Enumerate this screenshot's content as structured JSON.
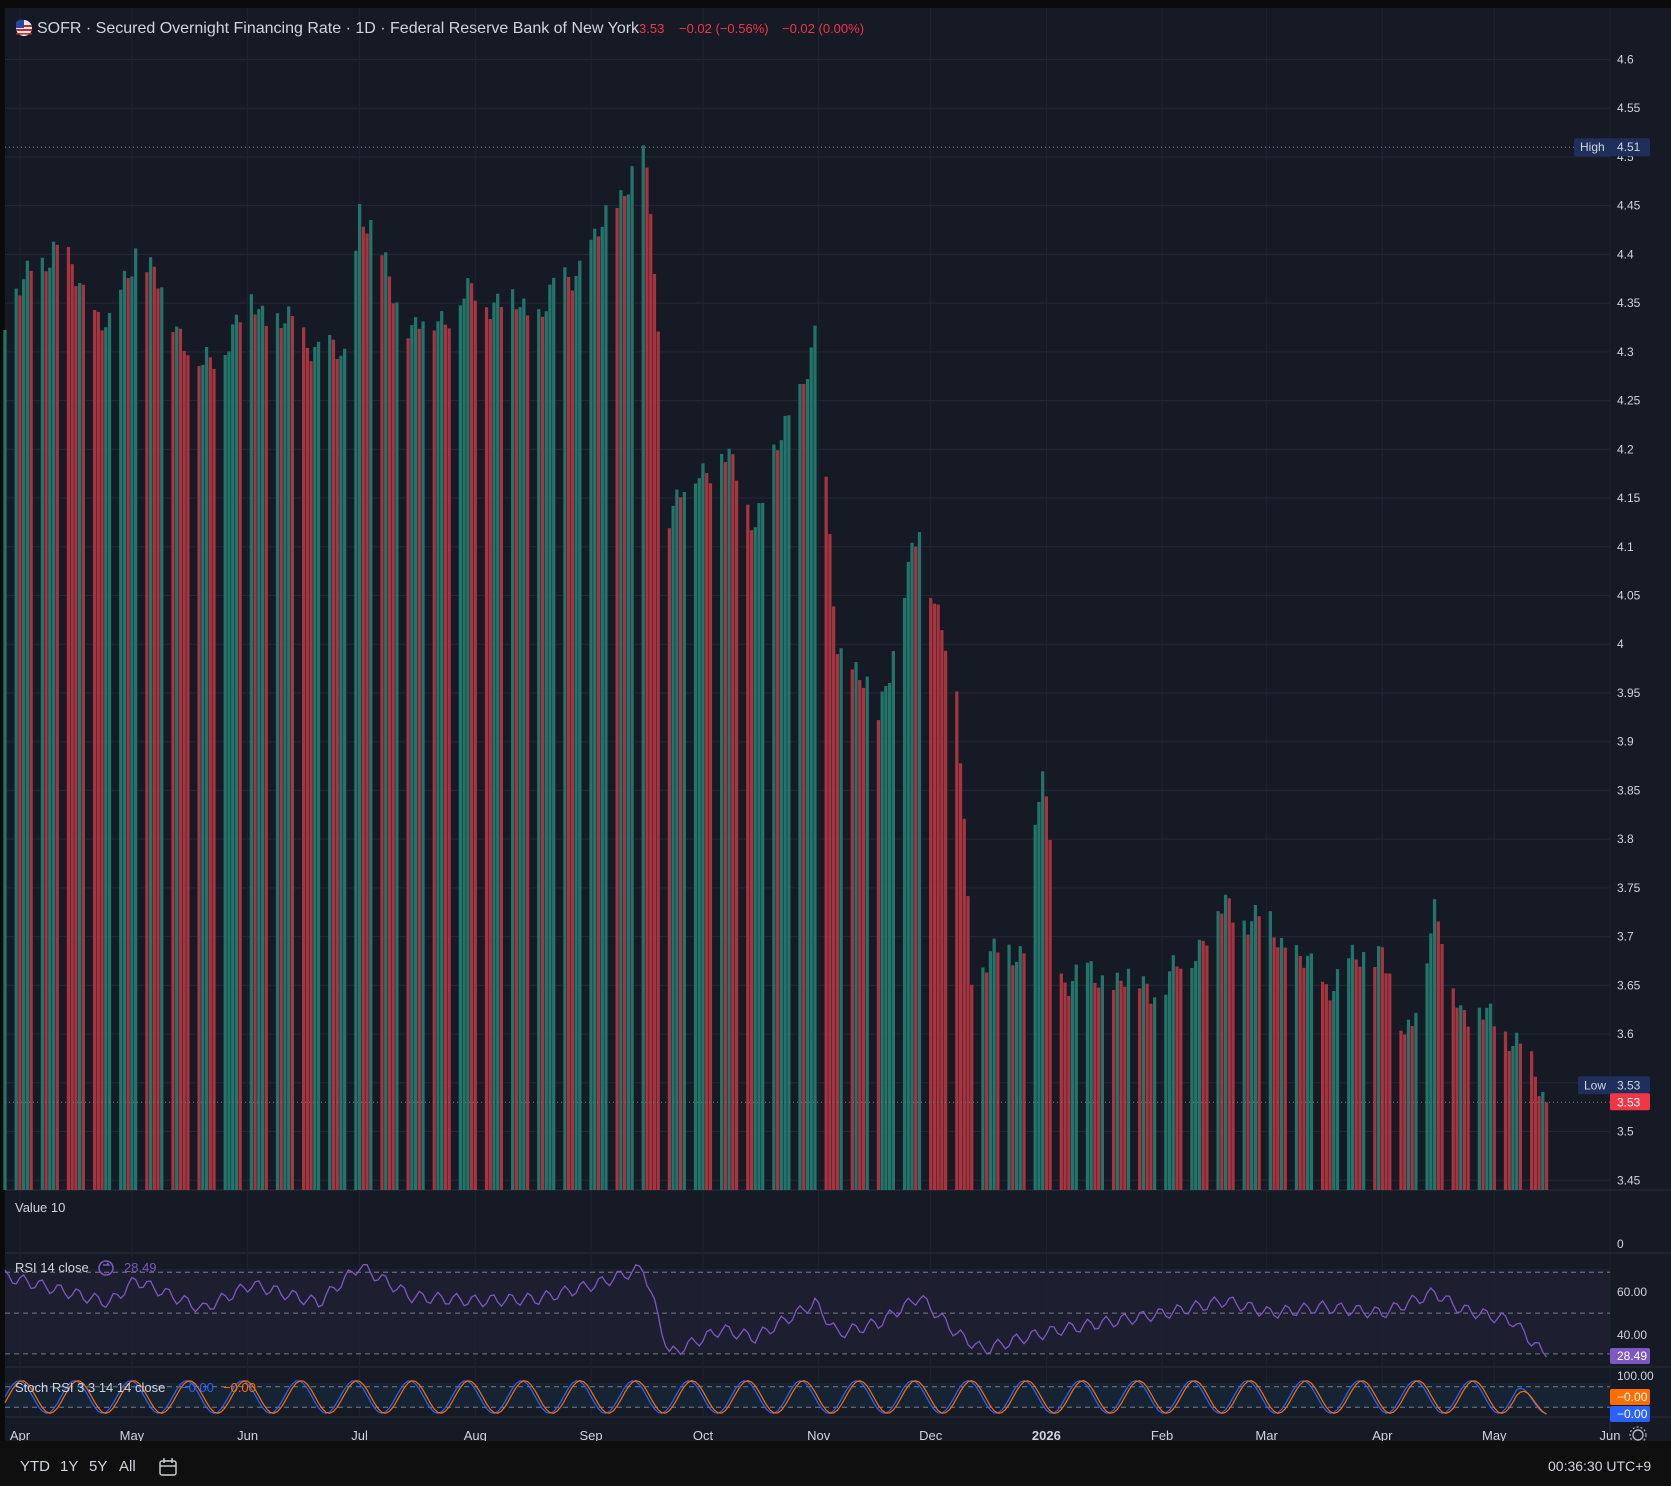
{
  "header": {
    "flag_icon": "us-flag-icon",
    "symbol": "SOFR",
    "title": "SOFR · Secured Overnight Financing Rate · 1D · Federal Reserve Bank of New York",
    "last": "3.53",
    "change": "−0.02 (−0.56%)",
    "change2": "−0.02 (0.00%)"
  },
  "price_axis": {
    "labels": [
      "4.6",
      "4.55",
      "4.5",
      "4.45",
      "4.4",
      "4.35",
      "4.3",
      "4.25",
      "4.2",
      "4.15",
      "4.1",
      "4.05",
      "4",
      "3.95",
      "3.9",
      "3.85",
      "3.8",
      "3.75",
      "3.7",
      "3.65",
      "3.6",
      "3.55",
      "3.5",
      "3.45"
    ],
    "high_label": "High",
    "high_value": "4.51",
    "low_label": "Low",
    "low_value": "3.53",
    "last_value": "3.53"
  },
  "volume_pane": {
    "label": "Value 10",
    "axis_zero": "0"
  },
  "rsi_pane": {
    "label": "RSI 14 close",
    "value": "28.49",
    "axis": [
      "60.00",
      "40.00"
    ],
    "last": "28.49"
  },
  "stoch_pane": {
    "label": "Stoch RSI 3 3 14 14 close",
    "k_value": "−0.00",
    "d_value": "−0.00",
    "axis_top": "100.00",
    "k_last": "−0.00",
    "d_last": "−0.00"
  },
  "time_axis": {
    "labels": [
      "Apr",
      "May",
      "Jun",
      "Jul",
      "Aug",
      "Sep",
      "Oct",
      "Nov",
      "Dec",
      "2026",
      "Feb",
      "Mar",
      "Apr",
      "May",
      "Jun"
    ]
  },
  "toolbar": {
    "ranges": [
      "YTD",
      "1Y",
      "5Y",
      "All"
    ],
    "calendar_icon": "calendar-goto-icon",
    "clock": "00:36:30 UTC+9",
    "settings_icon": "gear-icon"
  },
  "colors": {
    "up": "#22756a",
    "down": "#a83440",
    "rsi": "#7e57c2",
    "stoch_k": "#2962ff",
    "stoch_d": "#ff6d00",
    "background": "#161a25",
    "high_badge": "#1e2f5c",
    "last_badge": "#f23645"
  },
  "chart_data": [
    {
      "type": "bar",
      "title": "SOFR · Secured Overnight Financing Rate · 1D · Federal Reserve Bank of New York",
      "ylim": [
        3.44,
        4.62
      ],
      "x_range": [
        "2025-03-28",
        "2026-06-01"
      ],
      "series": [
        {
          "name": "SOFR",
          "segments": [
            {
              "x": [
                "2025-03-28",
                "2025-04-10"
              ],
              "values": [
                4.34,
                4.41
              ]
            },
            {
              "x": [
                "2025-04-10",
                "2025-04-25"
              ],
              "values": [
                4.41,
                4.32
              ]
            },
            {
              "x": [
                "2025-04-25",
                "2025-05-02"
              ],
              "values": [
                4.32,
                4.41
              ]
            },
            {
              "x": [
                "2025-05-02",
                "2025-05-20"
              ],
              "values": [
                4.41,
                4.28
              ]
            },
            {
              "x": [
                "2025-05-20",
                "2025-06-02"
              ],
              "values": [
                4.28,
                4.35
              ]
            },
            {
              "x": [
                "2025-06-02",
                "2025-06-27"
              ],
              "values": [
                4.35,
                4.29
              ]
            },
            {
              "x": [
                "2025-06-27",
                "2025-07-01"
              ],
              "values": [
                4.29,
                4.45
              ]
            },
            {
              "x": [
                "2025-07-01",
                "2025-07-15"
              ],
              "values": [
                4.45,
                4.32
              ]
            },
            {
              "x": [
                "2025-07-15",
                "2025-08-01"
              ],
              "values": [
                4.32,
                4.36
              ]
            },
            {
              "x": [
                "2025-08-01",
                "2025-08-18"
              ],
              "values": [
                4.36,
                4.34
              ]
            },
            {
              "x": [
                "2025-08-18",
                "2025-09-02"
              ],
              "values": [
                4.34,
                4.41
              ]
            },
            {
              "x": [
                "2025-09-02",
                "2025-09-15"
              ],
              "values": [
                4.41,
                4.51
              ]
            },
            {
              "x": [
                "2025-09-15",
                "2025-09-18"
              ],
              "values": [
                4.51,
                4.39
              ]
            },
            {
              "x": [
                "2025-09-18",
                "2025-09-22"
              ],
              "values": [
                4.39,
                4.14
              ]
            },
            {
              "x": [
                "2025-09-22",
                "2025-10-06"
              ],
              "values": [
                4.14,
                4.2
              ]
            },
            {
              "x": [
                "2025-10-06",
                "2025-10-15"
              ],
              "values": [
                4.2,
                4.13
              ]
            },
            {
              "x": [
                "2025-10-15",
                "2025-10-31"
              ],
              "values": [
                4.13,
                4.31
              ]
            },
            {
              "x": [
                "2025-10-31",
                "2025-11-06"
              ],
              "values": [
                4.31,
                4.0
              ]
            },
            {
              "x": [
                "2025-11-06",
                "2025-11-17"
              ],
              "values": [
                4.0,
                3.93
              ]
            },
            {
              "x": [
                "2025-11-17",
                "2025-11-28"
              ],
              "values": [
                3.93,
                4.12
              ]
            },
            {
              "x": [
                "2025-11-28",
                "2025-12-08"
              ],
              "values": [
                4.12,
                3.95
              ]
            },
            {
              "x": [
                "2025-12-08",
                "2025-12-12"
              ],
              "values": [
                3.95,
                3.67
              ]
            },
            {
              "x": [
                "2025-12-12",
                "2025-12-26"
              ],
              "values": [
                3.67,
                3.69
              ]
            },
            {
              "x": [
                "2025-12-26",
                "2025-12-31"
              ],
              "values": [
                3.69,
                3.87
              ]
            },
            {
              "x": [
                "2025-12-31",
                "2026-01-05"
              ],
              "values": [
                3.87,
                3.66
              ]
            },
            {
              "x": [
                "2026-01-05",
                "2026-02-02"
              ],
              "values": [
                3.66,
                3.65
              ]
            },
            {
              "x": [
                "2026-02-02",
                "2026-02-18"
              ],
              "values": [
                3.65,
                3.73
              ]
            },
            {
              "x": [
                "2026-02-18",
                "2026-03-02"
              ],
              "values": [
                3.73,
                3.71
              ]
            },
            {
              "x": [
                "2026-03-02",
                "2026-03-16"
              ],
              "values": [
                3.71,
                3.65
              ]
            },
            {
              "x": [
                "2026-03-16",
                "2026-04-01"
              ],
              "values": [
                3.65,
                3.69
              ]
            },
            {
              "x": [
                "2026-04-01",
                "2026-04-07"
              ],
              "values": [
                3.69,
                3.59
              ]
            },
            {
              "x": [
                "2026-04-07",
                "2026-04-15"
              ],
              "values": [
                3.59,
                3.72
              ]
            },
            {
              "x": [
                "2026-04-15",
                "2026-04-22"
              ],
              "values": [
                3.72,
                3.63
              ]
            },
            {
              "x": [
                "2026-04-22",
                "2026-05-06"
              ],
              "values": [
                3.63,
                3.6
              ]
            },
            {
              "x": [
                "2026-05-06",
                "2026-05-15"
              ],
              "values": [
                3.6,
                3.53
              ]
            }
          ]
        }
      ],
      "high": 4.51,
      "low": 3.53,
      "last": 3.53
    },
    {
      "type": "line",
      "title": "RSI 14 close",
      "ylim": [
        28,
        75
      ],
      "x_range": [
        "2025-03-28",
        "2026-06-01"
      ],
      "series": [
        {
          "name": "RSI 14 close",
          "x": [
            "2025-03-28",
            "2025-04-10",
            "2025-04-25",
            "2025-05-02",
            "2025-05-20",
            "2025-06-02",
            "2025-06-20",
            "2025-07-01",
            "2025-07-15",
            "2025-08-01",
            "2025-08-18",
            "2025-09-02",
            "2025-09-15",
            "2025-09-22",
            "2025-10-06",
            "2025-10-15",
            "2025-10-31",
            "2025-11-06",
            "2025-11-17",
            "2025-11-28",
            "2025-12-08",
            "2025-12-15",
            "2025-12-26",
            "2026-01-05",
            "2026-02-02",
            "2026-02-18",
            "2026-03-02",
            "2026-03-16",
            "2026-04-01",
            "2026-04-15",
            "2026-04-22",
            "2026-05-06",
            "2026-05-15"
          ],
          "values": [
            68,
            62,
            55,
            66,
            52,
            64,
            55,
            73,
            58,
            56,
            57,
            64,
            72,
            30,
            42,
            38,
            55,
            40,
            45,
            58,
            40,
            32,
            38,
            42,
            50,
            56,
            50,
            53,
            50,
            60,
            52,
            46,
            28.49
          ]
        }
      ],
      "levels": [
        70,
        50,
        30
      ],
      "last": 28.49
    },
    {
      "type": "line",
      "title": "Stoch RSI 3 3 14 14 close",
      "ylim": [
        0,
        100
      ],
      "x_range": [
        "2025-03-28",
        "2026-06-01"
      ],
      "series": [
        {
          "name": "K",
          "x": [
            "2025-03-28",
            "2025-06-02",
            "2025-07-01",
            "2025-08-18",
            "2025-09-15",
            "2025-10-31",
            "2025-11-28",
            "2026-01-05",
            "2026-02-18",
            "2026-04-15",
            "2026-05-15"
          ],
          "values": [
            60,
            55,
            95,
            60,
            90,
            70,
            95,
            40,
            85,
            90,
            0
          ]
        },
        {
          "name": "D",
          "x": [
            "2025-03-28",
            "2025-06-02",
            "2025-07-01",
            "2025-08-18",
            "2025-09-15",
            "2025-10-31",
            "2025-11-28",
            "2026-01-05",
            "2026-02-18",
            "2026-04-15",
            "2026-05-15"
          ],
          "values": [
            55,
            50,
            90,
            55,
            85,
            65,
            90,
            35,
            80,
            85,
            0
          ]
        }
      ],
      "levels": [
        80,
        20
      ],
      "last_k": -0.0,
      "last_d": -0.0
    }
  ]
}
